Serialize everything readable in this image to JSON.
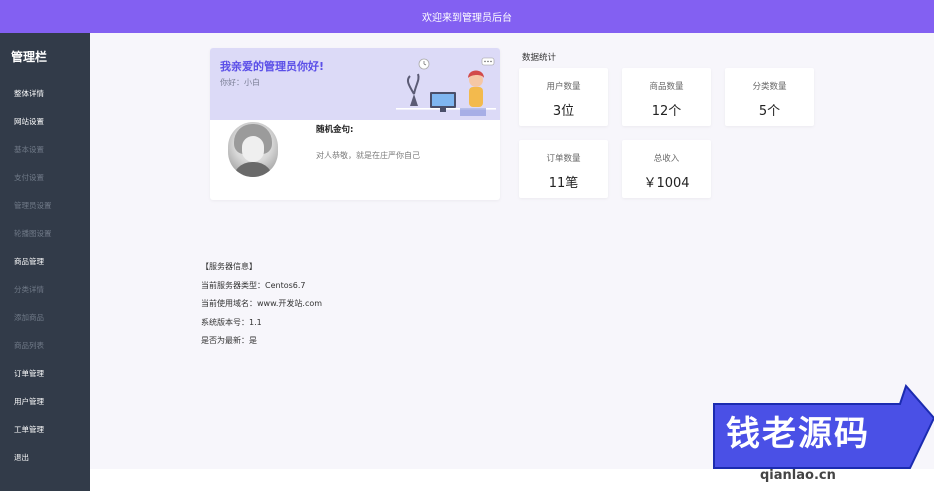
{
  "header": {
    "title": "欢迎来到管理员后台"
  },
  "sidebar": {
    "title": "管理栏",
    "items": [
      {
        "label": "整体详情",
        "bright": true
      },
      {
        "label": "网站设置",
        "bright": true
      },
      {
        "label": "基本设置",
        "bright": false
      },
      {
        "label": "支付设置",
        "bright": false
      },
      {
        "label": "管理员设置",
        "bright": false
      },
      {
        "label": "轮播图设置",
        "bright": false
      },
      {
        "label": "商品管理",
        "bright": true
      },
      {
        "label": "分类详情",
        "bright": false
      },
      {
        "label": "添加商品",
        "bright": false
      },
      {
        "label": "商品列表",
        "bright": false
      },
      {
        "label": "订单管理",
        "bright": true
      },
      {
        "label": "用户管理",
        "bright": true
      },
      {
        "label": "工单管理",
        "bright": true
      },
      {
        "label": "退出",
        "bright": true
      }
    ]
  },
  "welcome": {
    "title": "我亲爱的管理员你好!",
    "greeting": "你好：小白",
    "quote_label": "随机金句:",
    "quote": "对人恭敬，就是在庄严你自己"
  },
  "stats": {
    "title": "数据统计",
    "cards": [
      {
        "label": "用户数量",
        "value": "3位"
      },
      {
        "label": "商品数量",
        "value": "12个"
      },
      {
        "label": "分类数量",
        "value": "5个"
      },
      {
        "label": "订单数量",
        "value": "11笔"
      },
      {
        "label": "总收入",
        "value": "￥1004"
      }
    ]
  },
  "server": {
    "heading": "【服务器信息】",
    "type": "当前服务器类型：Centos6.7",
    "domain": "当前使用域名：www.开发站.com",
    "version": "系统版本号：1.1",
    "latest": "是否为最新：是"
  },
  "watermark": {
    "text": "钱老源码",
    "sub": "qianlao.cn"
  }
}
